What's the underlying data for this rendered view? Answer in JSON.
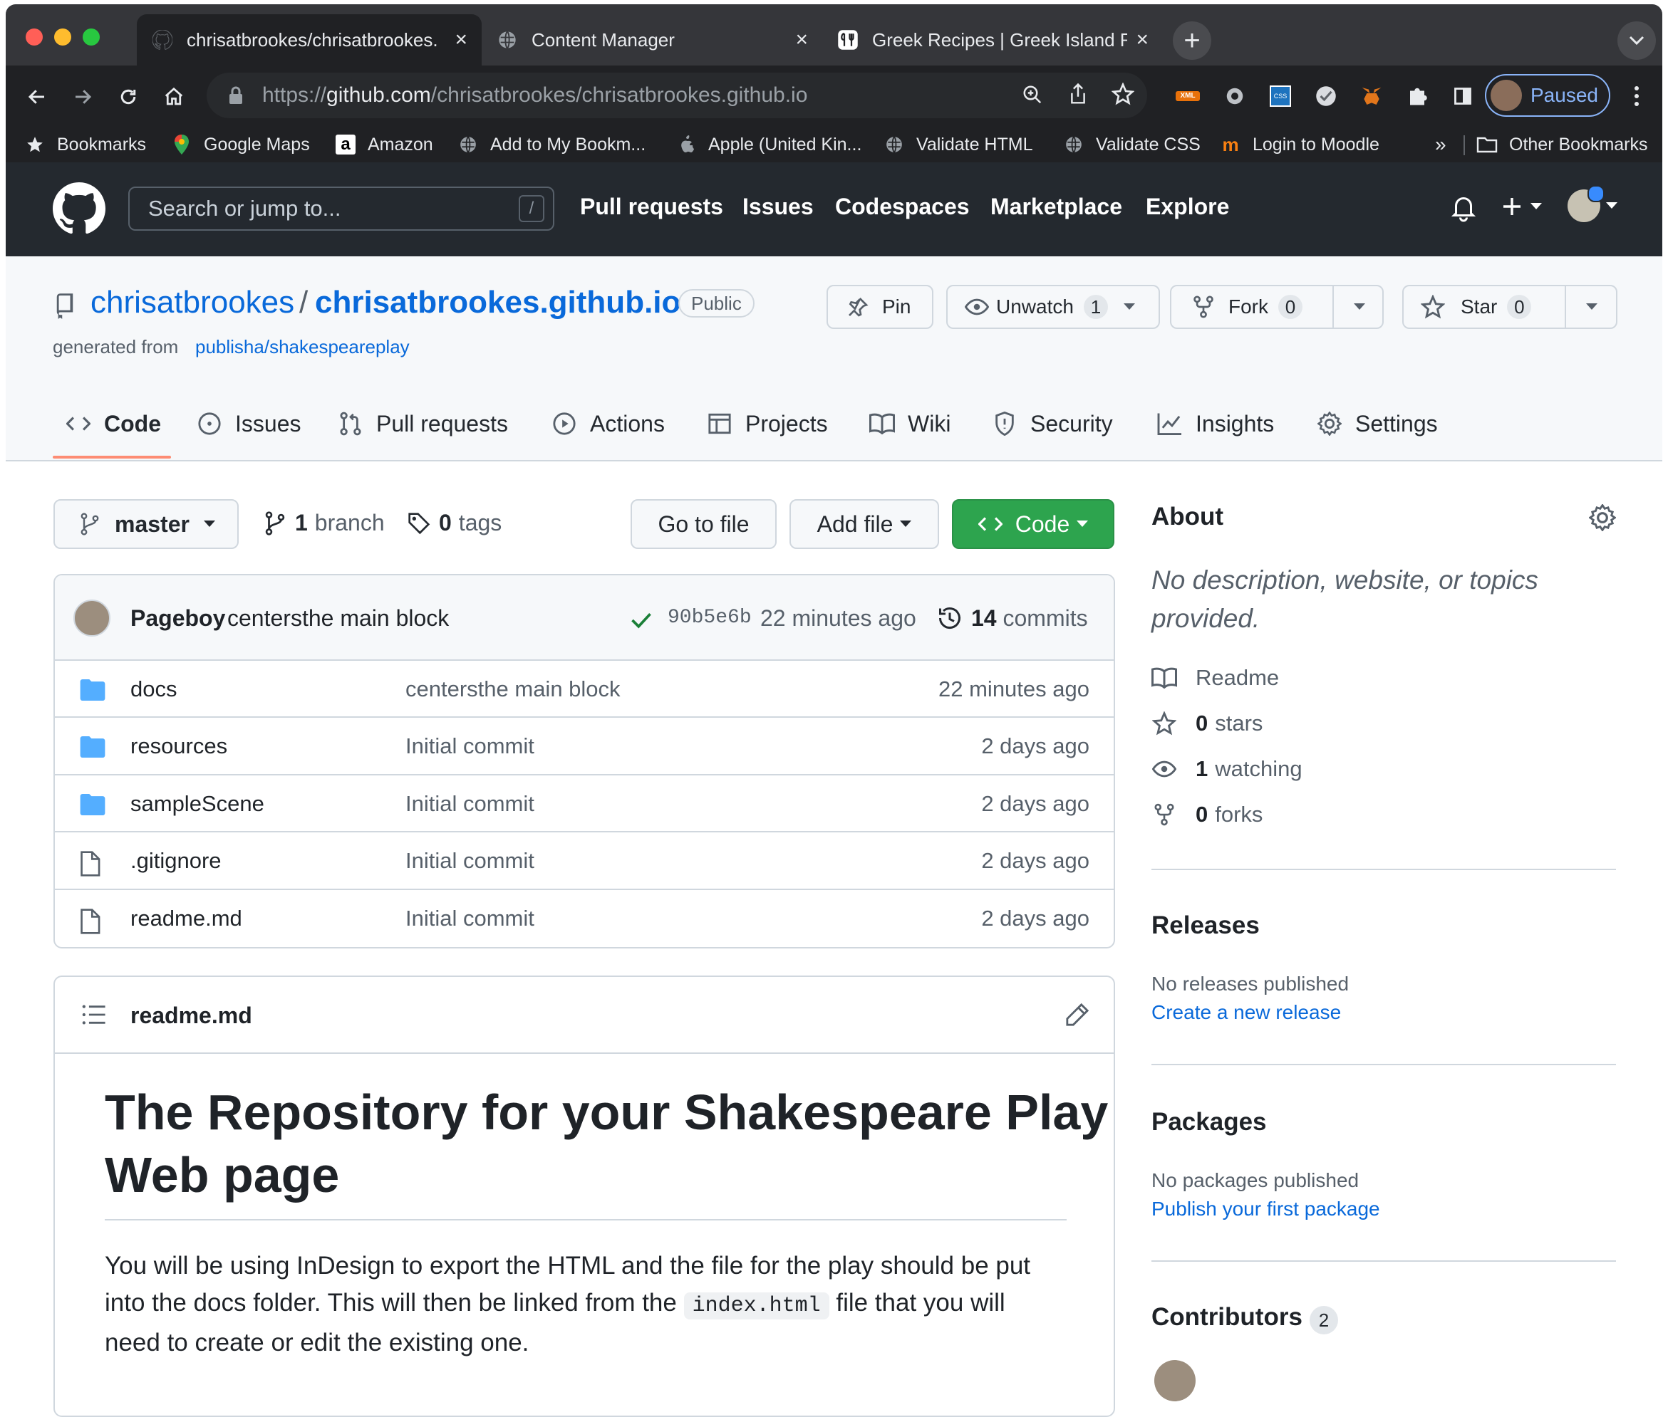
{
  "browser": {
    "tabs": [
      {
        "title": "chrisatbrookes/chrisatbrookes.",
        "icon": "github-icon",
        "active": true
      },
      {
        "title": "Content Manager",
        "icon": "globe-icon",
        "active": false
      },
      {
        "title": "Greek Recipes | Greek Island R",
        "icon": "recipe-icon",
        "active": false
      }
    ],
    "new_tab": "+",
    "url_scheme": "https://",
    "url_host": "github.com",
    "url_path": "/chrisatbrookes/chrisatbrookes.github.io",
    "profile_status": "Paused",
    "bookmarks": [
      {
        "label": "Bookmarks",
        "icon": "star-icon"
      },
      {
        "label": "Google Maps",
        "icon": "maps-icon"
      },
      {
        "label": "Amazon",
        "icon": "amazon-icon"
      },
      {
        "label": "Add to My Bookm...",
        "icon": "globe-icon"
      },
      {
        "label": "Apple (United Kin...",
        "icon": "apple-icon"
      },
      {
        "label": "Validate HTML",
        "icon": "globe-icon"
      },
      {
        "label": "Validate CSS",
        "icon": "globe-icon"
      },
      {
        "label": "Login to Moodle",
        "icon": "moodle-icon"
      }
    ],
    "bookmarks_overflow": "»",
    "other_bookmarks": "Other Bookmarks"
  },
  "gh_header": {
    "search_placeholder": "Search or jump to...",
    "search_shortcut": "/",
    "nav": [
      "Pull requests",
      "Issues",
      "Codespaces",
      "Marketplace",
      "Explore"
    ]
  },
  "repo": {
    "owner": "chrisatbrookes",
    "separator": "/",
    "name": "chrisatbrookes.github.io",
    "visibility": "Public",
    "generated_prefix": "generated from",
    "template": "publisha/shakespeareplay",
    "pin_label": "Pin",
    "watch_label": "Unwatch",
    "watch_count": "1",
    "fork_label": "Fork",
    "fork_count": "0",
    "star_label": "Star",
    "star_count": "0",
    "tabs": [
      {
        "label": "Code",
        "icon": "code-icon"
      },
      {
        "label": "Issues",
        "icon": "issue-icon"
      },
      {
        "label": "Pull requests",
        "icon": "pull-request-icon"
      },
      {
        "label": "Actions",
        "icon": "play-icon"
      },
      {
        "label": "Projects",
        "icon": "table-icon"
      },
      {
        "label": "Wiki",
        "icon": "book-icon"
      },
      {
        "label": "Security",
        "icon": "shield-icon"
      },
      {
        "label": "Insights",
        "icon": "graph-icon"
      },
      {
        "label": "Settings",
        "icon": "gear-icon"
      }
    ]
  },
  "filebar": {
    "branch": "master",
    "branch_count": "1",
    "branch_label": "branch",
    "tag_count": "0",
    "tag_label": "tags",
    "go_to_file": "Go to file",
    "add_file": "Add file",
    "code": "Code"
  },
  "commit": {
    "author": "Pageboy",
    "message": "centersthe main block",
    "sha": "90b5e6b",
    "time": "22 minutes ago",
    "count": "14",
    "count_label": "commits"
  },
  "files": [
    {
      "name": "docs",
      "type": "folder",
      "message": "centersthe main block",
      "date": "22 minutes ago"
    },
    {
      "name": "resources",
      "type": "folder",
      "message": "Initial commit",
      "date": "2 days ago"
    },
    {
      "name": "sampleScene",
      "type": "folder",
      "message": "Initial commit",
      "date": "2 days ago"
    },
    {
      "name": ".gitignore",
      "type": "file",
      "message": "Initial commit",
      "date": "2 days ago"
    },
    {
      "name": "readme.md",
      "type": "file",
      "message": "Initial commit",
      "date": "2 days ago"
    }
  ],
  "readme": {
    "filename": "readme.md",
    "heading_line1": "The Repository for your Shakespeare Play",
    "heading_line2": "Web page",
    "para_line1": "You will be using InDesign to export the HTML and the file for the play should be put",
    "para_line2a": "into the docs folder. This will then be linked from the",
    "para_code": "index.html",
    "para_line2b": "file that you will",
    "para_line3": "need to create or edit the existing one."
  },
  "about": {
    "title": "About",
    "description_line1": "No description, website, or topics",
    "description_line2": "provided.",
    "readme": "Readme",
    "stars_count": "0",
    "stars_label": "stars",
    "watching_count": "1",
    "watching_label": "watching",
    "forks_count": "0",
    "forks_label": "forks"
  },
  "releases": {
    "title": "Releases",
    "empty": "No releases published",
    "link": "Create a new release"
  },
  "packages": {
    "title": "Packages",
    "empty": "No packages published",
    "link": "Publish your first package"
  },
  "contributors": {
    "title": "Contributors",
    "count": "2"
  },
  "colors": {
    "accent": "#0969da",
    "primary_button": "#2da44e",
    "header_bg": "#24292f",
    "chrome_bg": "#35363a"
  }
}
